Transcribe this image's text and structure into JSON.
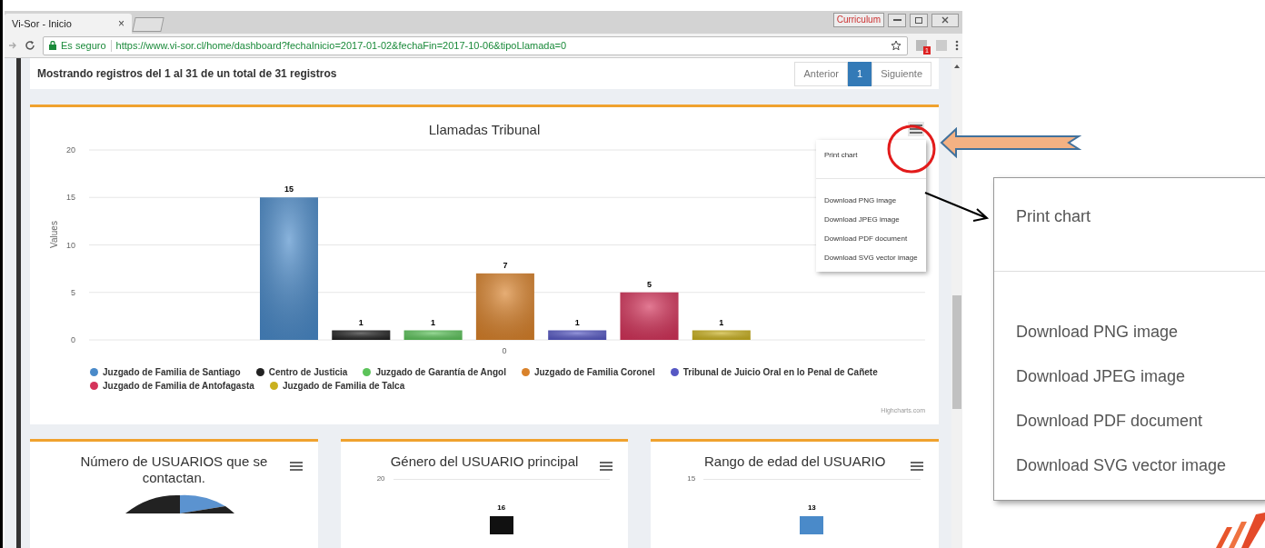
{
  "browser": {
    "tab": {
      "title": "Vi-Sor - Inicio",
      "close": "×"
    },
    "extension_badge": "Curriculum",
    "security": "Es seguro",
    "url": "https://www.vi-sor.cl/home/dashboard?fechaInicio=2017-01-02&fechaFin=2017-10-06&tipoLlamada=0",
    "notification_count": "1"
  },
  "records": {
    "summary": "Mostrando registros del 1 al 31 de un total de 31 registros",
    "pagination": [
      {
        "label": "Anterior",
        "selected": false
      },
      {
        "label": "1",
        "selected": true
      },
      {
        "label": "Siguiente",
        "selected": false
      }
    ]
  },
  "main_chart": {
    "title": "Llamadas Tribunal",
    "credit": "Highcharts.com",
    "chart_data": {
      "type": "bar",
      "ylabel": "Values",
      "categories": [
        "0"
      ],
      "yticks": [
        0,
        5,
        10,
        15,
        20
      ],
      "ylim": [
        0,
        20
      ],
      "data_labels": true,
      "grid": true,
      "series": [
        {
          "name": "Juzgado de Familia de Santiago",
          "color": "#4a8ac9",
          "values": [
            15
          ]
        },
        {
          "name": "Centro de Justicia",
          "color": "#222222",
          "values": [
            1
          ]
        },
        {
          "name": "Juzgado de Garantía de Angol",
          "color": "#5cc35a",
          "values": [
            1
          ]
        },
        {
          "name": "Juzgado de Familia Coronel",
          "color": "#d9822b",
          "values": [
            7
          ]
        },
        {
          "name": "Tribunal de Juicio Oral en lo Penal de Cañete",
          "color": "#5658c4",
          "values": [
            1
          ]
        },
        {
          "name": "Juzgado de Familia de Antofagasta",
          "color": "#d4335a",
          "values": [
            5
          ]
        },
        {
          "name": "Juzgado de Familia de Talca",
          "color": "#c9b01e",
          "values": [
            1
          ]
        }
      ]
    },
    "menu": {
      "groups": [
        [
          "Print chart"
        ],
        [
          "Download PNG image",
          "Download JPEG image",
          "Download PDF document",
          "Download SVG vector image"
        ]
      ]
    }
  },
  "small_charts": [
    {
      "title": "Número de USUARIOS que se contactan.",
      "kind": "pie"
    },
    {
      "title": "Género del USUARIO principal",
      "kind": "bar",
      "axis_label": "20",
      "bar_label": "16",
      "color": "#111111"
    },
    {
      "title": "Rango de edad del USUARIO",
      "kind": "bar",
      "axis_label": "15",
      "bar_label": "13",
      "color": "#4a8ac9"
    }
  ],
  "zoomed_menu": {
    "groups": [
      [
        "Print chart"
      ],
      [
        "Download PNG image",
        "Download JPEG image",
        "Download PDF document",
        "Download SVG vector image"
      ]
    ]
  }
}
